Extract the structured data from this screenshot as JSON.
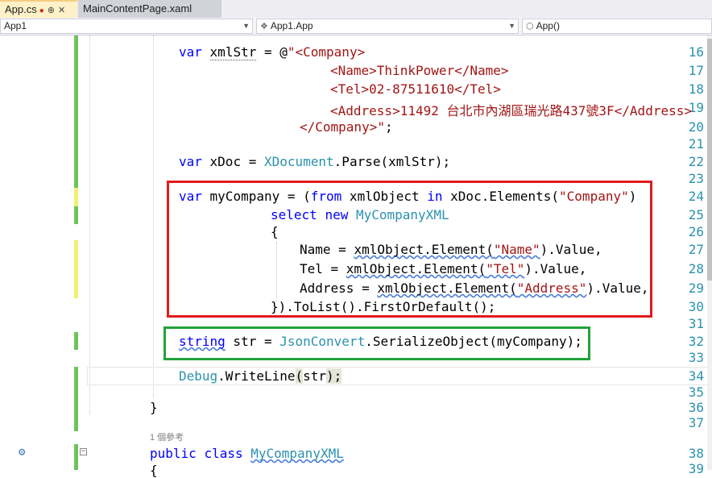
{
  "tabs": [
    {
      "label": "App.cs",
      "modified": "●",
      "pin": "⊕",
      "close": "✕"
    },
    {
      "label": "MainContentPage.xaml"
    }
  ],
  "nav": {
    "project": "App1",
    "class": "App1.App",
    "member": "App()"
  },
  "line_numbers": [
    "16",
    "17",
    "18",
    "19",
    "20",
    "21",
    "22",
    "23",
    "24",
    "25",
    "26",
    "27",
    "28",
    "29",
    "30",
    "31",
    "32",
    "33",
    "34",
    "35",
    "36",
    "37",
    "38",
    "39"
  ],
  "code": {
    "l16_kw": "var",
    "l16_id": "xmlStr",
    "l16_eq": " = @",
    "l16_str": "\"<Company>",
    "l17": "<Name>ThinkPower</Name>",
    "l18": "<Tel>02-87511610</Tel>",
    "l19": "<Address>11492 台北市內湖區瑞光路437號3F</Address>",
    "l20_str": "</Company>\"",
    "l20_end": ";",
    "l22_kw": "var",
    "l22_a": " xDoc = ",
    "l22_ty": "XDocument",
    "l22_b": ".Parse(xmlStr);",
    "l24_kw1": "var",
    "l24_a": " myCompany = (",
    "l24_kw2": "from",
    "l24_b": " xmlObject ",
    "l24_kw3": "in",
    "l24_c": " xDoc.Elements(",
    "l24_str": "\"Company\"",
    "l24_d": ")",
    "l25_kw1": "select",
    "l25_kw2": "new",
    "l25_ty": "MyCompanyXML",
    "l26": "{",
    "l27_a": "Name = ",
    "l27_b": "xmlObject.Element(",
    "l27_str": "\"Name\"",
    "l27_c": ").Value,",
    "l28_a": "Tel = ",
    "l28_b": "xmlObject.Element(",
    "l28_str": "\"Tel\"",
    "l28_c": ").Value,",
    "l29_a": "Address = ",
    "l29_b": "xmlObject.Element(",
    "l29_str": "\"Address\"",
    "l29_c": ").Value,",
    "l30": "}).ToList().FirstOrDefault();",
    "l32_kw": "string",
    "l32_a": " str = ",
    "l32_ty": "JsonConvert",
    "l32_b": ".SerializeObject(myCompany);",
    "l34_ty": "Debug",
    "l34_a": ".WriteLine",
    "l34_b": "(",
    "l34_c": "str",
    "l34_d": ");",
    "l36": "}",
    "refs": "1 個參考",
    "l38_kw1": "public",
    "l38_kw2": "class",
    "l38_ty": "MyCompanyXML",
    "l39": "{"
  },
  "colors": {
    "keyword": "#0000ff",
    "type": "#2b91af",
    "string": "#a31515",
    "markup": "#800000",
    "highlight_red": "#e01b1b",
    "highlight_green": "#21a33a"
  },
  "icons": [
    "pin-icon",
    "close-icon",
    "dropdown-arrow-icon",
    "class-icon",
    "method-icon",
    "outline-collapse-icon",
    "code-lens-icon"
  ]
}
